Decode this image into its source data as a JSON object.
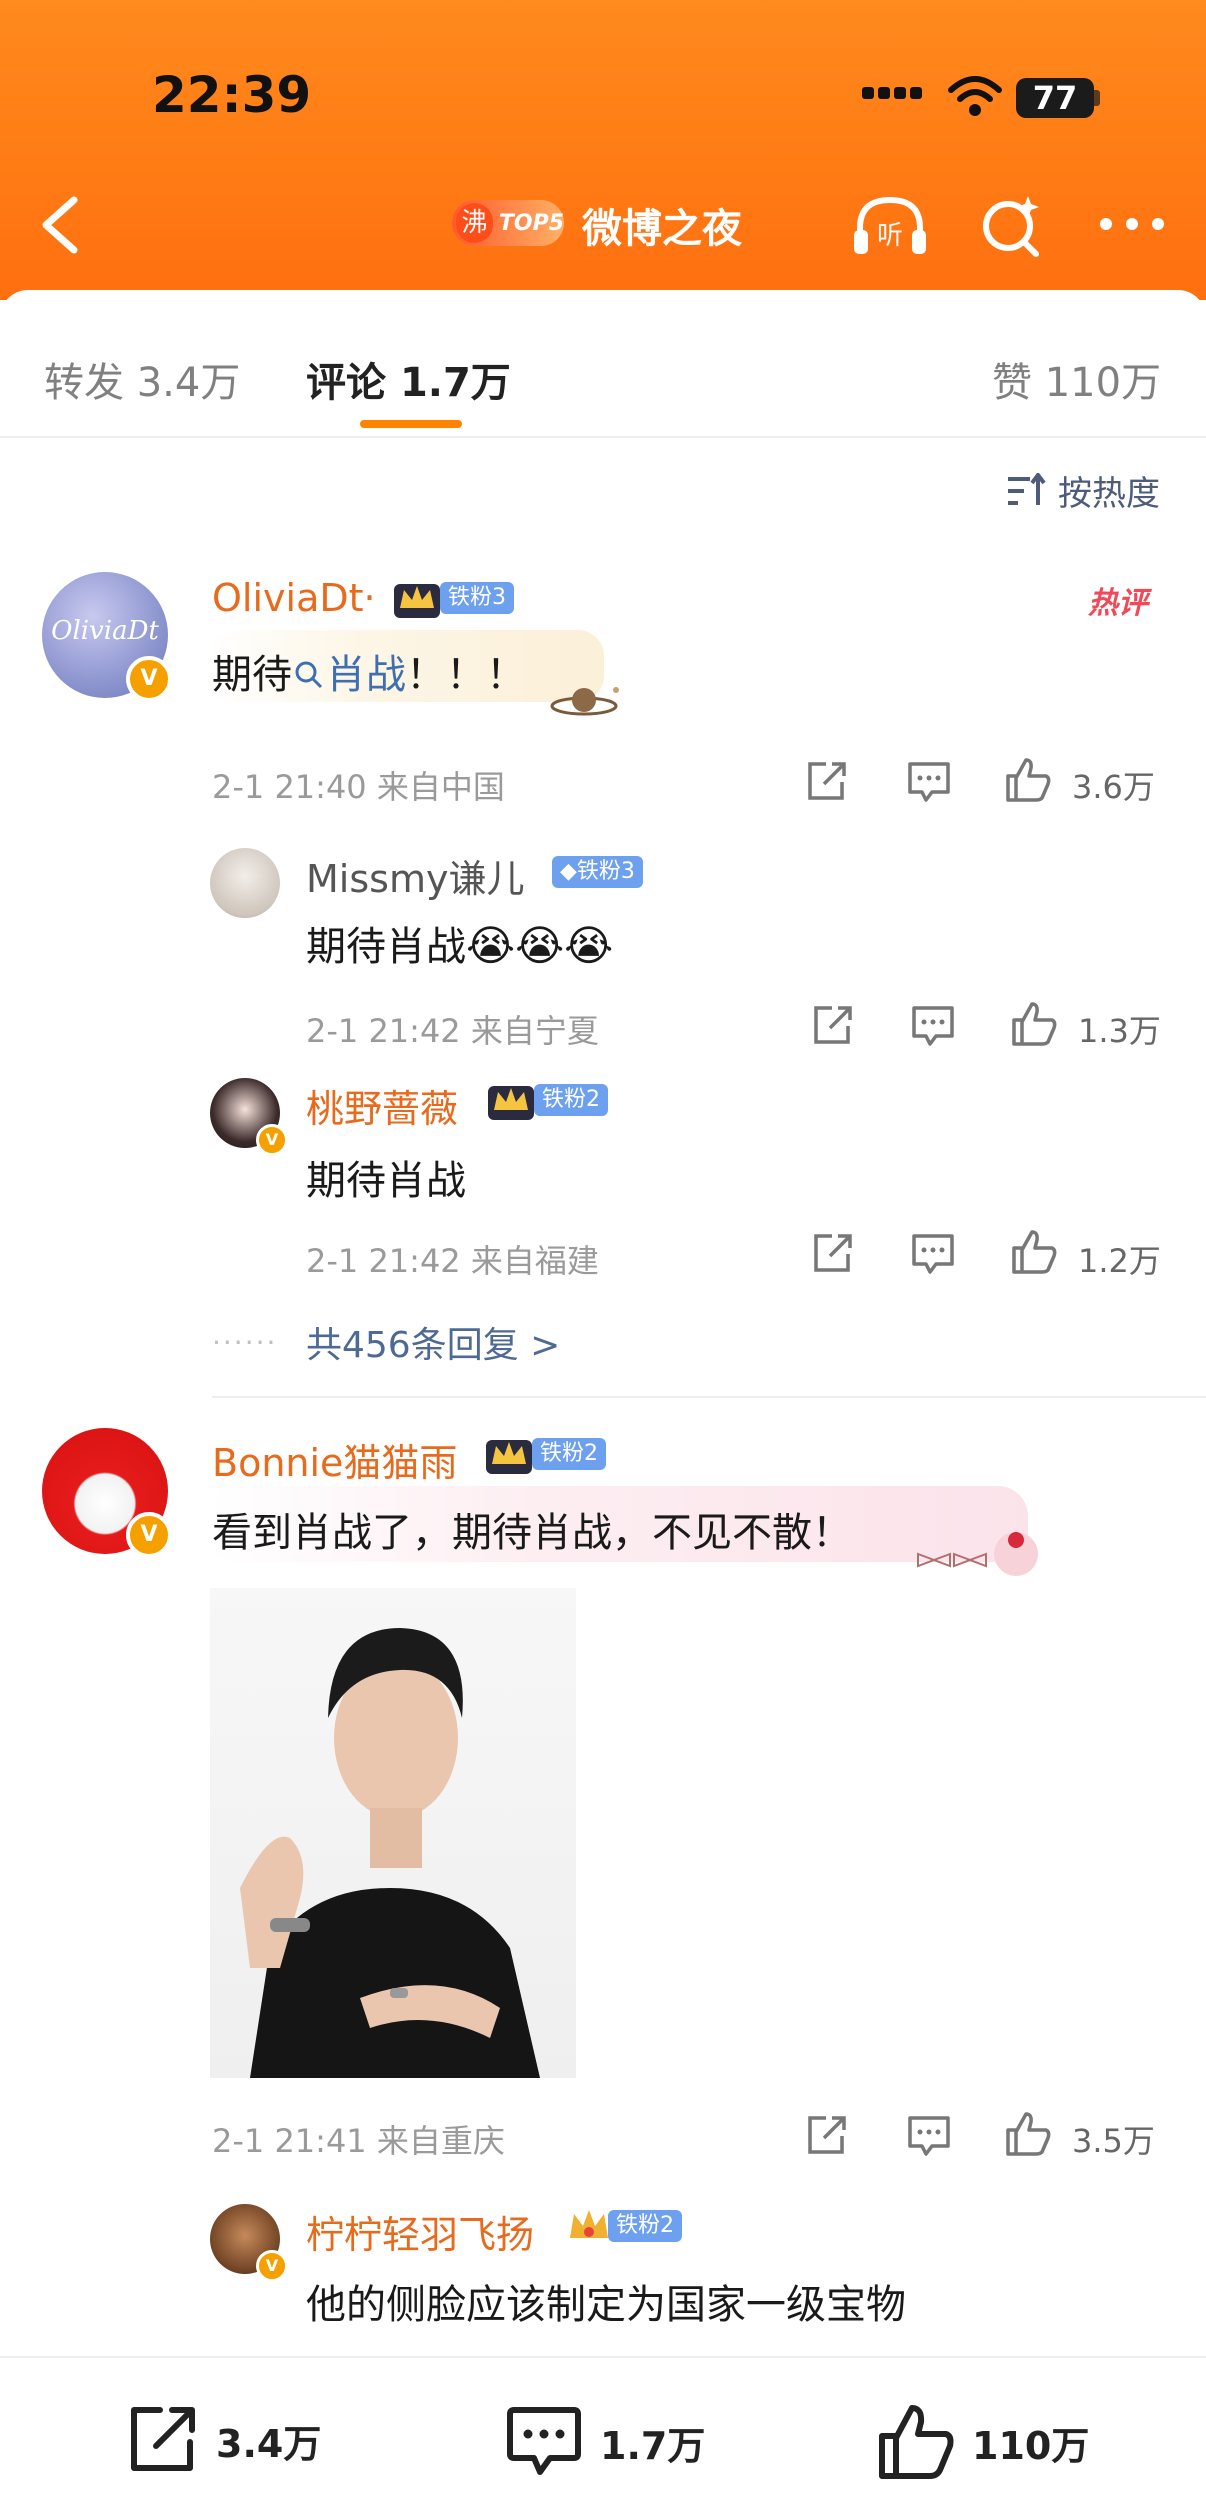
{
  "status_bar": {
    "time": "22:39",
    "battery": "77"
  },
  "header": {
    "badge_char": "沸",
    "badge_rank": "TOP5",
    "title": "微博之夜"
  },
  "tabs": {
    "repost": {
      "label": "转发",
      "count": "3.4万"
    },
    "comments": {
      "label": "评论",
      "count": "1.7万"
    },
    "likes": {
      "label": "赞",
      "count": "110万"
    }
  },
  "sort": {
    "label": "按热度"
  },
  "comments": [
    {
      "user": "OliviaDt·",
      "avatar_text": "OliviaDt",
      "fan_badge": "铁粉3",
      "hot_tag": "热评",
      "text_prefix": "期待",
      "text_link": "肖战",
      "text_suffix": "！！！",
      "time": "2-1 21:40",
      "location": "来自中国",
      "likes": "3.6万",
      "replies": [
        {
          "user": "Missmy谦儿",
          "fan_badge": "铁粉3",
          "text": "期待肖战",
          "emoji": "😭😭😭",
          "time": "2-1 21:42",
          "location": "来自宁夏",
          "likes": "1.3万"
        },
        {
          "user": "桃野蔷薇",
          "fan_badge": "铁粉2",
          "text": "期待肖战",
          "time": "2-1 21:42",
          "location": "来自福建",
          "likes": "1.2万"
        }
      ],
      "reply_summary": "共456条回复 >"
    },
    {
      "user": "Bonnie猫猫雨",
      "fan_badge": "铁粉2",
      "text": "看到肖战了，期待肖战，不见不散！",
      "time": "2-1 21:41",
      "location": "来自重庆",
      "likes": "3.5万",
      "replies": [
        {
          "user": "柠柠轻羽飞扬",
          "fan_badge": "铁粉2",
          "text": "他的侧脸应该制定为国家一级宝物"
        }
      ]
    }
  ],
  "bottom_bar": {
    "repost": "3.4万",
    "comments": "1.7万",
    "likes": "110万"
  },
  "colors": {
    "header": "#ff7a14",
    "username": "#e86a1c",
    "link": "#3f6fb2",
    "accent": "#ff8200"
  }
}
